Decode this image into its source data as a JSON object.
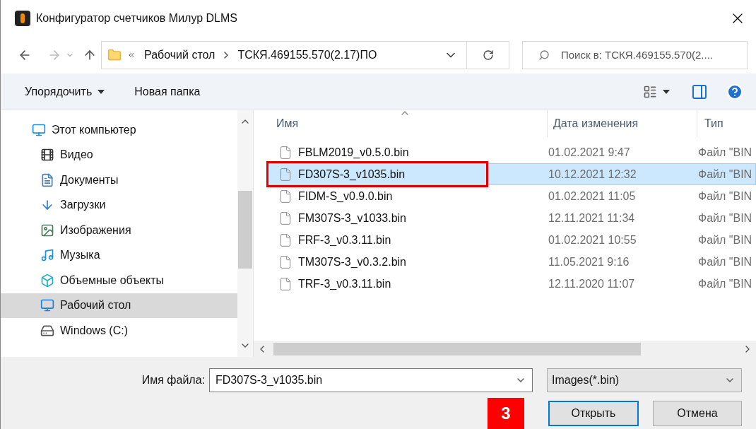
{
  "window": {
    "title": "Конфигуратор счетчиков Милур DLMS"
  },
  "address": {
    "breadcrumbs": [
      "Рабочий стол",
      "ТСКЯ.469155.570(2.17)ПО"
    ]
  },
  "search": {
    "placeholder": "Поиск в: ТСКЯ.469155.570(2...."
  },
  "toolbar": {
    "buttons": [
      "Упорядочить",
      "Новая папка"
    ]
  },
  "sidebar": {
    "items": [
      {
        "label": "Этот компьютер",
        "kind": "computer",
        "selected": false,
        "children": [
          {
            "label": "Видео",
            "kind": "video",
            "selected": false
          },
          {
            "label": "Документы",
            "kind": "documents",
            "selected": false
          },
          {
            "label": "Загрузки",
            "kind": "downloads",
            "selected": false
          },
          {
            "label": "Изображения",
            "kind": "pictures",
            "selected": false
          },
          {
            "label": "Музыка",
            "kind": "music",
            "selected": false
          },
          {
            "label": "Объемные объекты",
            "kind": "objects3d",
            "selected": false
          },
          {
            "label": "Рабочий стол",
            "kind": "desktop",
            "selected": true
          },
          {
            "label": "Windows (C:)",
            "kind": "drive",
            "selected": false
          }
        ]
      }
    ]
  },
  "table": {
    "columns": [
      "Имя",
      "Дата изменения",
      "Тип"
    ],
    "rows": [
      {
        "name": "FBLM2019_v0.5.0.bin",
        "date": "01.02.2021 9:47",
        "type": "Файл \"BIN",
        "selected": false,
        "highlighted": false
      },
      {
        "name": "FD307S-3_v1035.bin",
        "date": "10.12.2021 12:32",
        "type": "Файл \"BIN",
        "selected": true,
        "highlighted": true
      },
      {
        "name": "FIDM-S_v0.9.0.bin",
        "date": "01.02.2021 11:05",
        "type": "Файл \"BIN",
        "selected": false,
        "highlighted": false
      },
      {
        "name": "FM307S-3_v1033.bin",
        "date": "12.11.2021 11:34",
        "type": "Файл \"BIN",
        "selected": false,
        "highlighted": false
      },
      {
        "name": "FRF-3_v0.3.11.bin",
        "date": "01.02.2021 10:55",
        "type": "Файл \"BIN",
        "selected": false,
        "highlighted": false
      },
      {
        "name": "TM307S-3_v0.3.2.bin",
        "date": "11.05.2021 9:16",
        "type": "Файл \"BIN",
        "selected": false,
        "highlighted": false
      },
      {
        "name": "TRF-3_v0.3.11.bin",
        "date": "12.11.2020 11:07",
        "type": "Файл \"BIN",
        "selected": false,
        "highlighted": false
      }
    ]
  },
  "footer": {
    "filename_label": "Имя файла:",
    "filename_value": "FD307S-3_v1035.bin",
    "filter": "Images(*.bin)",
    "annotation_badge": "3",
    "open_button": "Открыть",
    "cancel_button": "Отмена"
  }
}
